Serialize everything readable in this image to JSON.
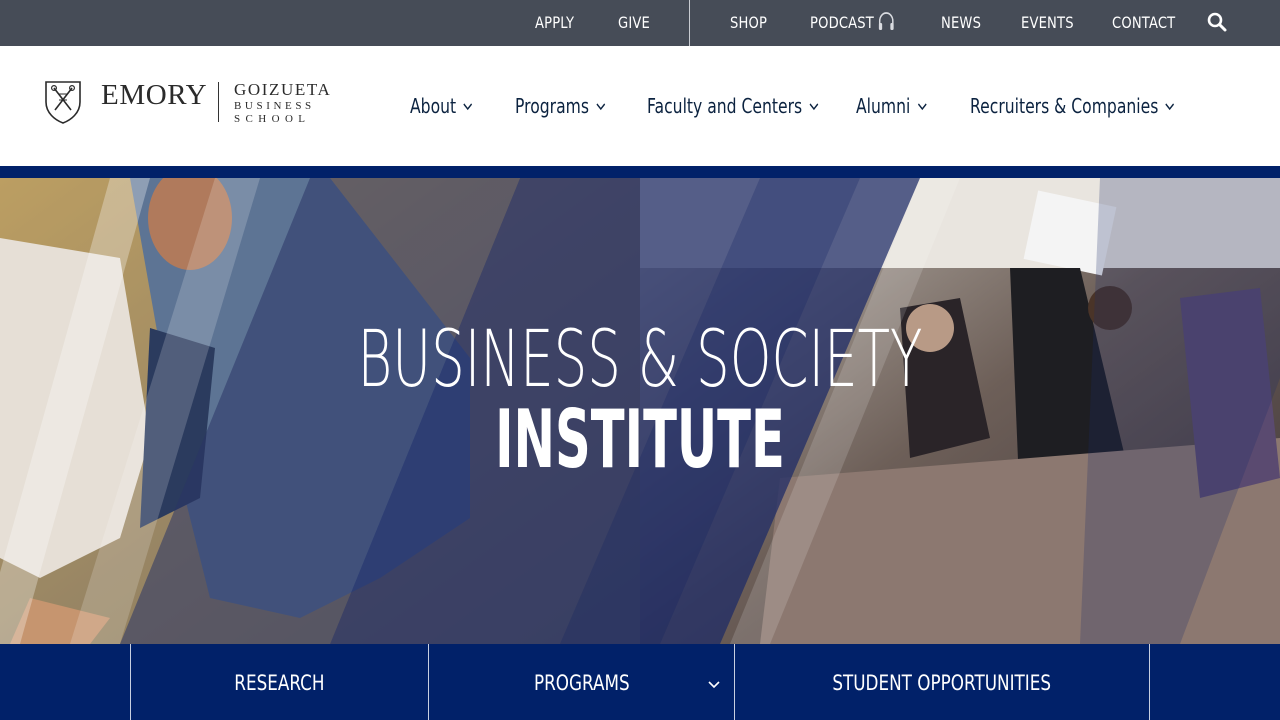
{
  "utility_nav": {
    "items": [
      {
        "label": "APPLY"
      },
      {
        "label": "GIVE"
      },
      {
        "label": "SHOP"
      },
      {
        "label": "PODCAST"
      },
      {
        "label": "NEWS"
      },
      {
        "label": "EVENTS"
      },
      {
        "label": "CONTACT"
      }
    ],
    "podcast_icon": "headphones-icon",
    "search_icon": "search-icon"
  },
  "logo": {
    "emory": "EMORY",
    "goizueta": "GOIZUETA",
    "business": "BUSINESS",
    "school": "SCHOOL"
  },
  "main_nav": {
    "items": [
      {
        "label": "About"
      },
      {
        "label": "Programs"
      },
      {
        "label": "Faculty and Centers"
      },
      {
        "label": "Alumni"
      },
      {
        "label": "Recruiters & Companies"
      }
    ],
    "chevron_icon": "chevron-down-icon"
  },
  "hero": {
    "line1": "BUSINESS & SOCIETY",
    "line2": "INSTITUTE"
  },
  "subnav": {
    "items": [
      {
        "label": "RESEARCH"
      },
      {
        "label": "PROGRAMS"
      },
      {
        "label": "STUDENT OPPORTUNITIES"
      }
    ]
  },
  "colors": {
    "utility_bg": "#464c57",
    "brand_navy": "#012169",
    "nav_text": "#0c2340"
  }
}
